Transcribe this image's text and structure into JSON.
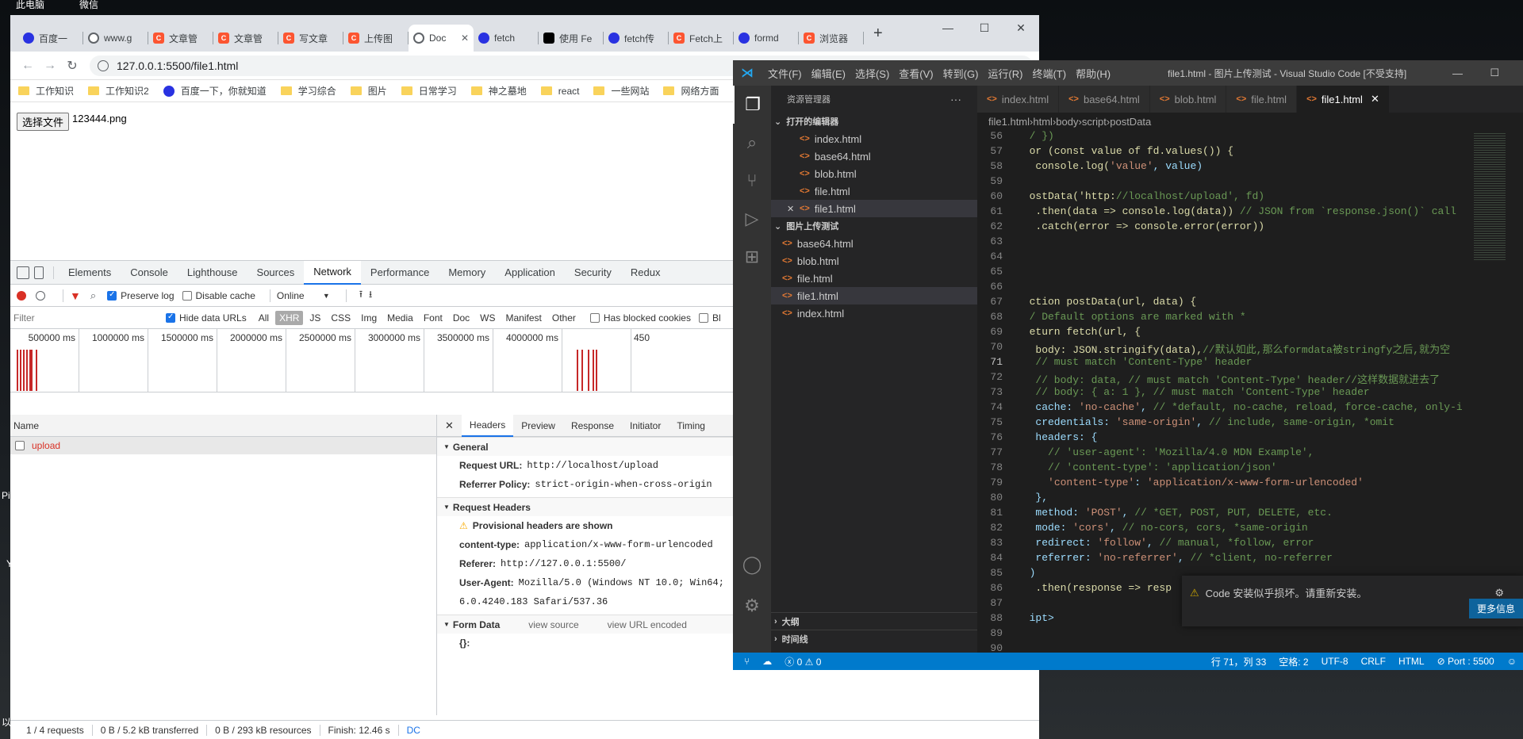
{
  "desktop": {
    "icons": [
      "此电脑",
      "微信"
    ],
    "left_chars": [
      "Pi",
      "Y",
      "以"
    ]
  },
  "chrome": {
    "tabs": [
      {
        "label": "百度一",
        "icon": "baidu"
      },
      {
        "label": "www.g",
        "icon": "globe"
      },
      {
        "label": "文章管",
        "icon": "csdn"
      },
      {
        "label": "文章管",
        "icon": "csdn"
      },
      {
        "label": "写文章",
        "icon": "csdn"
      },
      {
        "label": "上传图",
        "icon": "csdn"
      },
      {
        "label": "Doc",
        "icon": "globe",
        "active": true
      },
      {
        "label": "fetch",
        "icon": "baidu"
      },
      {
        "label": "使用 Fe",
        "icon": "gh"
      },
      {
        "label": "fetch传",
        "icon": "baidu"
      },
      {
        "label": "Fetch上",
        "icon": "csdn"
      },
      {
        "label": "formd",
        "icon": "baidu"
      },
      {
        "label": "浏览器",
        "icon": "csdn"
      }
    ],
    "newtab": "+",
    "url": "127.0.0.1:5500/file1.html",
    "bookmarks": [
      "工作知识",
      "工作知识2",
      "百度一下，你就知道",
      "学习综合",
      "图片",
      "日常学习",
      "神之墓地",
      "react",
      "一些网站",
      "网络方面"
    ],
    "page": {
      "file_button": "选择文件",
      "file_name": "123444.png"
    }
  },
  "devtools": {
    "tabs": [
      "Elements",
      "Console",
      "Lighthouse",
      "Sources",
      "Network",
      "Performance",
      "Memory",
      "Application",
      "Security",
      "Redux"
    ],
    "active_tab": "Network",
    "netbar": {
      "preserve_log": "Preserve log",
      "disable_cache": "Disable cache",
      "throttle": "Online"
    },
    "filter": {
      "placeholder": "Filter",
      "hide_data_urls": "Hide data URLs",
      "types": [
        "All",
        "XHR",
        "JS",
        "CSS",
        "Img",
        "Media",
        "Font",
        "Doc",
        "WS",
        "Manifest",
        "Other"
      ],
      "blocked": "Has blocked cookies",
      "bl": "Bl"
    },
    "timeline_ticks": [
      "500000 ms",
      "1000000 ms",
      "1500000 ms",
      "2000000 ms",
      "2500000 ms",
      "3000000 ms",
      "3500000 ms",
      "4000000 ms",
      "450"
    ],
    "name_header": "Name",
    "requests": [
      "upload"
    ],
    "detail_tabs": [
      "Headers",
      "Preview",
      "Response",
      "Initiator",
      "Timing"
    ],
    "general": {
      "title": "General",
      "request_url_k": "Request URL:",
      "request_url_v": "http://localhost/upload",
      "referrer_policy_k": "Referrer Policy:",
      "referrer_policy_v": "strict-origin-when-cross-origin"
    },
    "request_headers": {
      "title": "Request Headers",
      "warning": "Provisional headers are shown",
      "content_type_k": "content-type:",
      "content_type_v": "application/x-www-form-urlencoded",
      "referer_k": "Referer:",
      "referer_v": "http://127.0.0.1:5500/",
      "ua_k": "User-Agent:",
      "ua_v": "Mozilla/5.0 (Windows NT 10.0; Win64;",
      "ua_v2": "6.0.4240.183 Safari/537.36"
    },
    "form_data": {
      "title": "Form Data",
      "view_source": "view source",
      "view_url": "view URL encoded",
      "value": "{}:"
    },
    "status": [
      "1 / 4 requests",
      "0 B / 5.2 kB transferred",
      "0 B / 293 kB resources",
      "Finish: 12.46 s",
      "DC"
    ]
  },
  "vscode": {
    "menus": [
      "文件(F)",
      "编辑(E)",
      "选择(S)",
      "查看(V)",
      "转到(G)",
      "运行(R)",
      "终端(T)",
      "帮助(H)"
    ],
    "title": "file1.html - 图片上传测试 - Visual Studio Code [不受支持]",
    "explorer_title": "资源管理器",
    "open_editors_title": "打开的编辑器",
    "open_editors": [
      "index.html",
      "base64.html",
      "blob.html",
      "file.html",
      "file1.html"
    ],
    "project_title": "图片上传测试",
    "project_files": [
      "base64.html",
      "blob.html",
      "file.html",
      "file1.html",
      "index.html"
    ],
    "outline": "大纲",
    "timeline": "时间线",
    "editor_tabs": [
      "index.html",
      "base64.html",
      "blob.html",
      "file.html",
      "file1.html"
    ],
    "breadcrumbs": [
      "file1.html",
      "html",
      "body",
      "script",
      "postData"
    ],
    "code_lines": [
      {
        "n": "56",
        "t": "  / })"
      },
      {
        "n": "57",
        "t": "  or (const value of fd.values()) {"
      },
      {
        "n": "58",
        "t": "   console.log('value', value)"
      },
      {
        "n": "59",
        "t": ""
      },
      {
        "n": "60",
        "t": "  ostData('http://localhost/upload', fd)"
      },
      {
        "n": "61",
        "t": "   .then(data => console.log(data)) // JSON from `response.json()` call"
      },
      {
        "n": "62",
        "t": "   .catch(error => console.error(error))"
      },
      {
        "n": "63",
        "t": ""
      },
      {
        "n": "64",
        "t": ""
      },
      {
        "n": "65",
        "t": ""
      },
      {
        "n": "66",
        "t": ""
      },
      {
        "n": "67",
        "t": "  ction postData(url, data) {"
      },
      {
        "n": "68",
        "t": "  / Default options are marked with *"
      },
      {
        "n": "69",
        "t": "  eturn fetch(url, {"
      },
      {
        "n": "70",
        "t": "   body: JSON.stringify(data),//默认如此,那么formdata被stringfy之后,就为空"
      },
      {
        "n": "71",
        "t": "   // must match 'Content-Type' header"
      },
      {
        "n": "72",
        "t": "   // body: data, // must match 'Content-Type' header//这样数据就进去了"
      },
      {
        "n": "73",
        "t": "   // body: { a: 1 }, // must match 'Content-Type' header"
      },
      {
        "n": "74",
        "t": "   cache: 'no-cache', // *default, no-cache, reload, force-cache, only-i"
      },
      {
        "n": "75",
        "t": "   credentials: 'same-origin', // include, same-origin, *omit"
      },
      {
        "n": "76",
        "t": "   headers: {"
      },
      {
        "n": "77",
        "t": "     // 'user-agent': 'Mozilla/4.0 MDN Example',"
      },
      {
        "n": "78",
        "t": "     // 'content-type': 'application/json'"
      },
      {
        "n": "79",
        "t": "     'content-type': 'application/x-www-form-urlencoded'"
      },
      {
        "n": "80",
        "t": "   },"
      },
      {
        "n": "81",
        "t": "   method: 'POST', // *GET, POST, PUT, DELETE, etc."
      },
      {
        "n": "82",
        "t": "   mode: 'cors', // no-cors, cors, *same-origin"
      },
      {
        "n": "83",
        "t": "   redirect: 'follow', // manual, *follow, error"
      },
      {
        "n": "84",
        "t": "   referrer: 'no-referrer', // *client, no-referrer"
      },
      {
        "n": "85",
        "t": "  )"
      },
      {
        "n": "86",
        "t": "   .then(response => resp"
      },
      {
        "n": "87",
        "t": ""
      },
      {
        "n": "88",
        "t": "  ipt>"
      },
      {
        "n": "89",
        "t": ""
      },
      {
        "n": "90",
        "t": ""
      }
    ],
    "current_line": "71",
    "notification": {
      "text": "Code 安装似乎损坏。请重新安装。",
      "button": "更多信息"
    },
    "status": {
      "errors": "0",
      "warnings": "0",
      "position": "行 71，列 33",
      "spaces": "空格: 2",
      "encoding": "UTF-8",
      "eol": "CRLF",
      "lang": "HTML",
      "port": "Port : 5500"
    }
  }
}
